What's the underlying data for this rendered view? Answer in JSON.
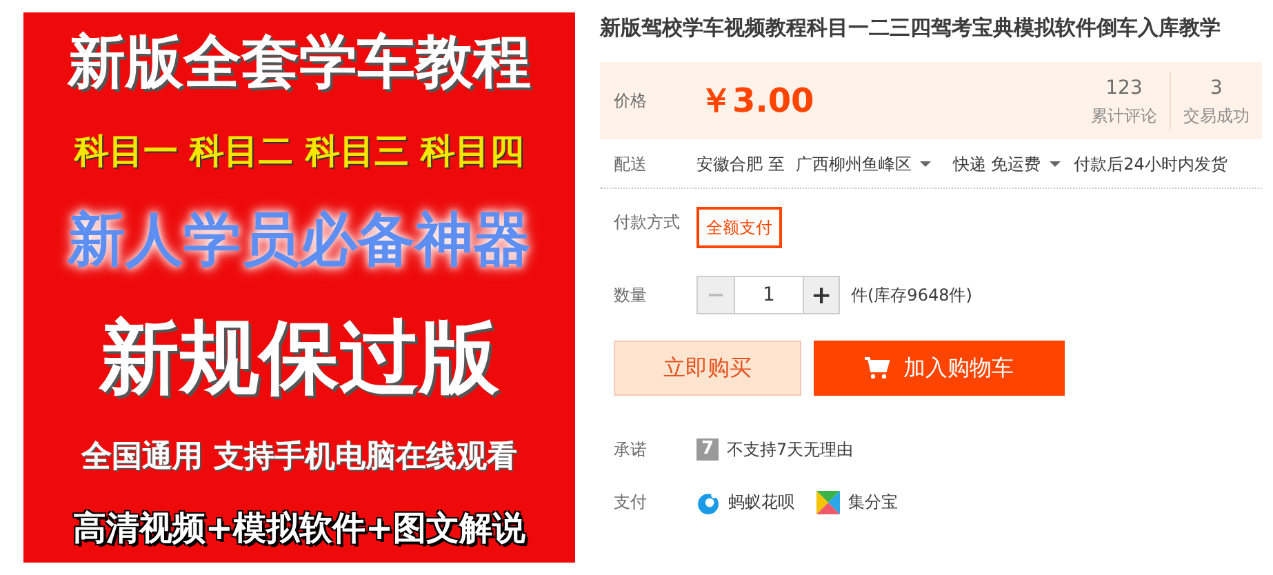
{
  "banner": {
    "lines": [
      {
        "text": "新版全套学车教程",
        "kind": "headline"
      },
      {
        "text": "科目一 科目二 科目三 科目四",
        "kind": "yellow"
      },
      {
        "text": "新人学员必备神器",
        "kind": "glow"
      },
      {
        "text": "新规保过版",
        "kind": "big"
      },
      {
        "text": "全国通用 支持手机电脑在线观看",
        "kind": "small"
      },
      {
        "text": "高清视频+模拟软件+图文解说",
        "kind": "outline"
      }
    ]
  },
  "title": "新版驾校学车视频教程科目一二三四驾考宝典模拟软件倒车入库教学",
  "price": {
    "label": "价格",
    "currency": "￥",
    "amount": "3.00",
    "stats": [
      {
        "value": "123",
        "label": "累计评论"
      },
      {
        "value": "3",
        "label": "交易成功"
      }
    ]
  },
  "delivery": {
    "label": "配送",
    "from": "安徽合肥 至",
    "to": "广西柳州鱼峰区",
    "shipping": "快递 免运费",
    "dispatch": "付款后24小时内发货"
  },
  "payment_method": {
    "label": "付款方式",
    "options": [
      {
        "label": "全额支付",
        "selected": true
      }
    ]
  },
  "quantity": {
    "label": "数量",
    "decrement": "−",
    "value": "1",
    "increment": "+",
    "stock": "件(库存9648件)"
  },
  "buttons": {
    "buy": "立即购买",
    "cart": "加入购物车"
  },
  "promise": {
    "label": "承诺",
    "badge": "7",
    "text": "不支持7天无理由"
  },
  "pay": {
    "label": "支付",
    "methods": [
      {
        "name": "蚂蚁花呗",
        "kind": "huabei"
      },
      {
        "name": "集分宝",
        "kind": "jifenbao"
      }
    ]
  }
}
